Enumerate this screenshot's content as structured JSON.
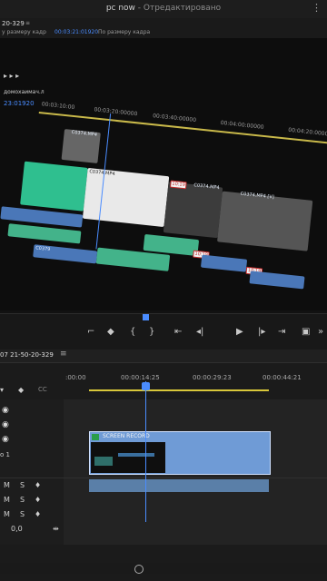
{
  "titlebar": {
    "project": "pc now",
    "status": "- Отредактировано"
  },
  "sequence": {
    "name": "20-329",
    "timecode_top": "00:03:21:01920",
    "fit": "По размеру кадра",
    "panel_label": "у размеру кадр"
  },
  "monitor": {
    "seq_tab": "домохаимач.л",
    "timecode": "23:01920",
    "ruler": [
      "00:03:10:00",
      "00:03:20:00000",
      "00:03:40:00000",
      "00:04:00:00000",
      "00:04:20:00000"
    ],
    "clips": [
      "C0374.MP4",
      "C0374.MP4",
      "C0374.MP4",
      "C0374.MP4",
      "C0374.MP4 [V]",
      "C0379"
    ],
    "fx_badges": [
      "10:19",
      "10:19",
      "10:19",
      "10:19"
    ]
  },
  "transport": {
    "icons": [
      "mark-in-icon",
      "marker-icon",
      "bracket-left-icon",
      "bracket-right-icon",
      "go-to-in-icon",
      "step-back-icon",
      "play-icon",
      "step-forward-icon",
      "go-to-out-icon",
      "export-frame-icon",
      "more-icon"
    ]
  },
  "lower": {
    "sequence_name": "07 21-50-20-329",
    "ruler": [
      ":00:00",
      "00:00:14:25",
      "00:00:29:23",
      "00:00:44:21"
    ],
    "clip_label": "SCREEN RECORD",
    "track_v1": "o 1",
    "audio_rows": [
      "M",
      "M",
      "M"
    ],
    "solo": [
      "S",
      "S",
      "S"
    ],
    "level": "0,0"
  }
}
